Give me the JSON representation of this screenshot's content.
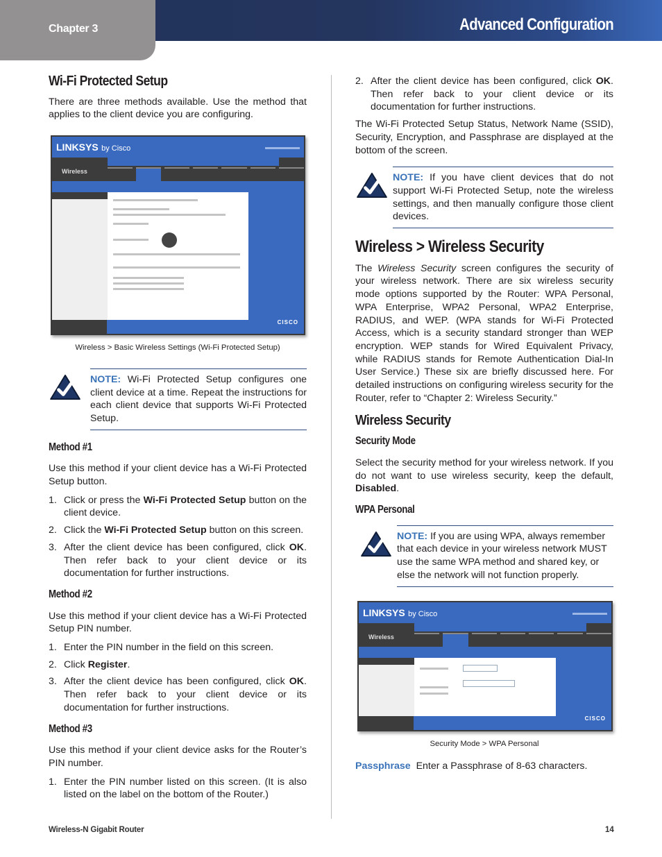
{
  "header": {
    "chapter": "Chapter 3",
    "title": "Advanced Configuration"
  },
  "left": {
    "wps_heading": "Wi-Fi Protected Setup",
    "wps_intro": "There are three methods available. Use the method that applies to the client device you are configuring.",
    "screenshot1": {
      "brand": "LINKSYS",
      "brand_suffix": "by Cisco",
      "section": "Wireless",
      "cisco": "CISCO",
      "caption": "Wireless > Basic Wireless Settings (Wi-Fi Protected Setup)"
    },
    "note1": {
      "label": "NOTE:",
      "text": " Wi-Fi Protected Setup configures one client device at a time. Repeat the instructions for each client device that supports Wi-Fi Protected Setup."
    },
    "method1": {
      "heading": "Method #1",
      "intro": "Use this method if your client device has a Wi-Fi Protected Setup button.",
      "steps": [
        {
          "num": "1.",
          "pre": "Click or press the ",
          "bold": "Wi-Fi Protected Setup",
          "post": " button on the client device."
        },
        {
          "num": "2.",
          "pre": "Click the ",
          "bold": "Wi-Fi Protected Setup",
          "post": " button on this screen."
        },
        {
          "num": "3.",
          "pre": "After the client device has been configured, click ",
          "bold": "OK",
          "post": ". Then refer back to your client device or its documentation for further instructions."
        }
      ]
    },
    "method2": {
      "heading": "Method #2",
      "intro": "Use this method if your client device has a Wi-Fi Protected Setup PIN number.",
      "steps": [
        {
          "num": "1.",
          "pre": "Enter the PIN number in the field on this screen.",
          "bold": "",
          "post": ""
        },
        {
          "num": "2.",
          "pre": "Click ",
          "bold": "Register",
          "post": "."
        },
        {
          "num": "3.",
          "pre": "After the client device has been configured, click ",
          "bold": "OK",
          "post": ". Then refer back to your client device or its documentation for further instructions."
        }
      ]
    },
    "method3": {
      "heading": "Method #3",
      "intro": "Use this method if your client device asks for the Router’s PIN number.",
      "steps": [
        {
          "num": "1.",
          "pre": "Enter the PIN number listed on this screen. (It is also listed on the label on the bottom of the Router.)",
          "bold": "",
          "post": ""
        }
      ]
    }
  },
  "right": {
    "step2": {
      "num": "2.",
      "pre": "After the client device has been configured, click ",
      "bold": "OK",
      "post": ". Then refer back to your client device or its documentation for further instructions."
    },
    "status_para": "The Wi-Fi Protected Setup Status, Network Name (SSID), Security, Encryption, and Passphrase are displayed at the bottom of the screen.",
    "note2": {
      "label": "NOTE:",
      "text": " If you have client devices that do not support Wi-Fi Protected Setup, note the wireless settings, and then manually configure those client devices."
    },
    "ws_heading": "Wireless > Wireless Security",
    "ws_para": {
      "pre": "The ",
      "italic": "Wireless Security",
      "post": " screen configures the security of your wireless network. There are six wireless security mode options supported by the Router: WPA Personal, WPA Enterprise, WPA2 Personal, WPA2 Enterprise, RADIUS, and WEP. (WPA stands for Wi-Fi Protected Access, which is a security standard stronger than WEP encryption. WEP stands for Wired Equivalent Privacy, while RADIUS stands for Remote Authentication Dial-In User Service.) These six are briefly discussed here. For detailed instructions on configuring wireless security for the Router, refer to “Chapter 2: Wireless Security.”"
    },
    "ws_subheading": "Wireless Security",
    "sm_heading": "Security Mode",
    "sm_para": {
      "pre": "Select the security method for your wireless network. If you do not want to use wireless security, keep the default, ",
      "bold": "Disabled",
      "post": "."
    },
    "wpa_heading": "WPA Personal",
    "note3": {
      "label": "NOTE:",
      "text": " If you are using WPA, always remember that each device in your wireless network MUST use the same WPA method and shared key, or else the network will not function properly."
    },
    "screenshot2": {
      "brand": "LINKSYS",
      "brand_suffix": "by Cisco",
      "section": "Wireless",
      "cisco": "CISCO",
      "caption": "Security Mode > WPA Personal"
    },
    "passphrase": {
      "term": "Passphrase",
      "text": "Enter a Passphrase of 8-63 characters."
    }
  },
  "footer": {
    "product": "Wireless-N Gigabit Router",
    "page": "14"
  }
}
